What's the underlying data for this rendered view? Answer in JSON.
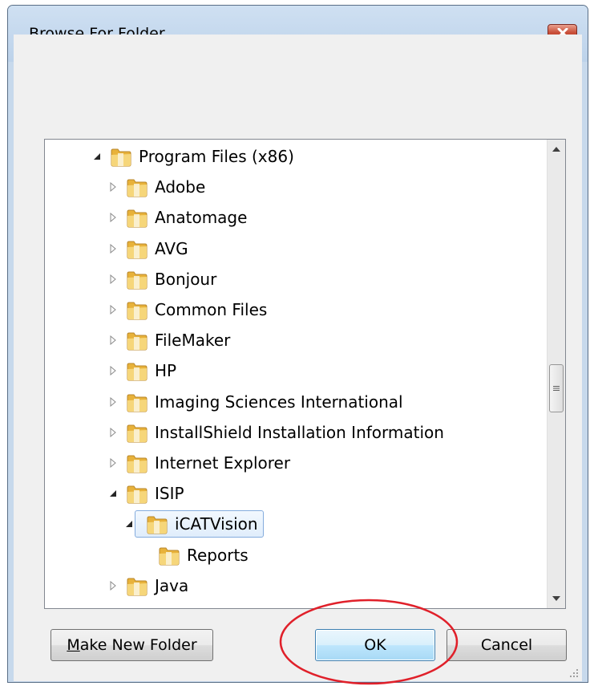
{
  "window": {
    "title": "Browse For Folder",
    "close_icon": "close-icon"
  },
  "tree": {
    "items": [
      {
        "label": "Program Files (x86)",
        "expander": "expanded",
        "selected": false
      },
      {
        "label": "Adobe",
        "expander": "collapsed",
        "selected": false
      },
      {
        "label": "Anatomage",
        "expander": "collapsed",
        "selected": false
      },
      {
        "label": "AVG",
        "expander": "collapsed",
        "selected": false
      },
      {
        "label": "Bonjour",
        "expander": "collapsed",
        "selected": false
      },
      {
        "label": "Common Files",
        "expander": "collapsed",
        "selected": false
      },
      {
        "label": "FileMaker",
        "expander": "collapsed",
        "selected": false
      },
      {
        "label": "HP",
        "expander": "collapsed",
        "selected": false
      },
      {
        "label": "Imaging Sciences International",
        "expander": "collapsed",
        "selected": false
      },
      {
        "label": "InstallShield Installation Information",
        "expander": "collapsed",
        "selected": false
      },
      {
        "label": "Internet Explorer",
        "expander": "collapsed",
        "selected": false
      },
      {
        "label": "ISIP",
        "expander": "expanded",
        "selected": false
      },
      {
        "label": "iCATVision",
        "expander": "expanded",
        "selected": true
      },
      {
        "label": "Reports",
        "expander": "none",
        "selected": false
      },
      {
        "label": "Java",
        "expander": "collapsed",
        "selected": false
      }
    ]
  },
  "buttons": {
    "make_new_folder_mnemonic": "M",
    "make_new_folder_rest": "ake New Folder",
    "ok": "OK",
    "cancel": "Cancel"
  },
  "colors": {
    "selection_border": "#84acdd",
    "annotation_circle": "#e0202a",
    "default_button_border": "#3c7fb1"
  }
}
